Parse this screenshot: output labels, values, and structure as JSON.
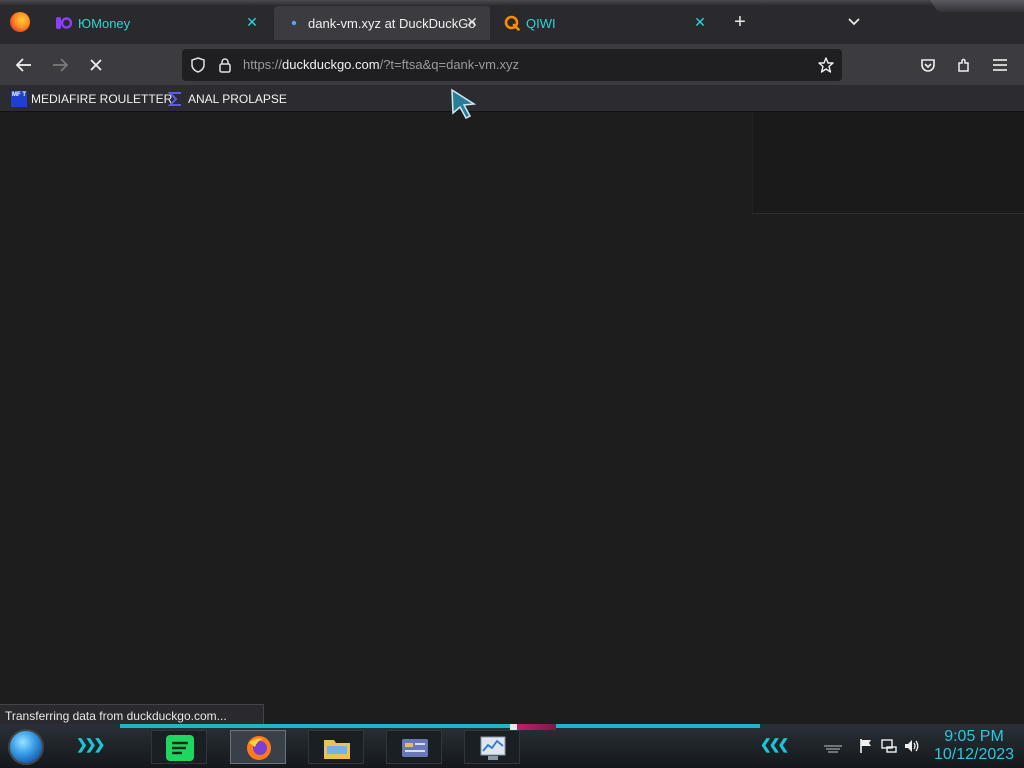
{
  "browser": {
    "tabs": [
      {
        "title": "ЮMoney",
        "icon": "yoomoney-icon",
        "active": false
      },
      {
        "title": "dank-vm.xyz at DuckDuckGo",
        "icon": "loading-dot-icon",
        "active": true
      },
      {
        "title": "QIWI",
        "icon": "qiwi-icon",
        "active": false
      }
    ],
    "close_glyph": "✕",
    "new_tab_glyph": "+",
    "url": {
      "scheme": "https://",
      "host": "duckduckgo.com",
      "rest": "/?t=ftsa&q=dank-vm.xyz"
    },
    "bookmarks": [
      {
        "label": "MEDIAFIRE ROULETTER",
        "icon": "mft-icon",
        "icon_text": "MF T"
      },
      {
        "label": "ANAL PROLAPSE",
        "icon": "sigma-icon"
      }
    ],
    "status_text": "Transferring data from duckduckgo.com...",
    "loading": true
  },
  "colors": {
    "accent_cyan": "#29d6d6",
    "toolbar": "#3b3b40",
    "tabbar": "#2a2a2e",
    "content_bg": "#1d1d1d",
    "clock": "#27c9e0"
  },
  "taskbar": {
    "apps": [
      {
        "name": "spotify-app",
        "active": false
      },
      {
        "name": "firefox-app",
        "active": true
      },
      {
        "name": "file-explorer-app",
        "active": false
      },
      {
        "name": "control-panel-app",
        "active": false
      },
      {
        "name": "resource-monitor-app",
        "active": false
      }
    ],
    "tray_icons": [
      "flag-icon",
      "network-icon",
      "volume-icon"
    ],
    "clock": {
      "time": "9:05 PM",
      "date": "10/12/2023"
    }
  }
}
